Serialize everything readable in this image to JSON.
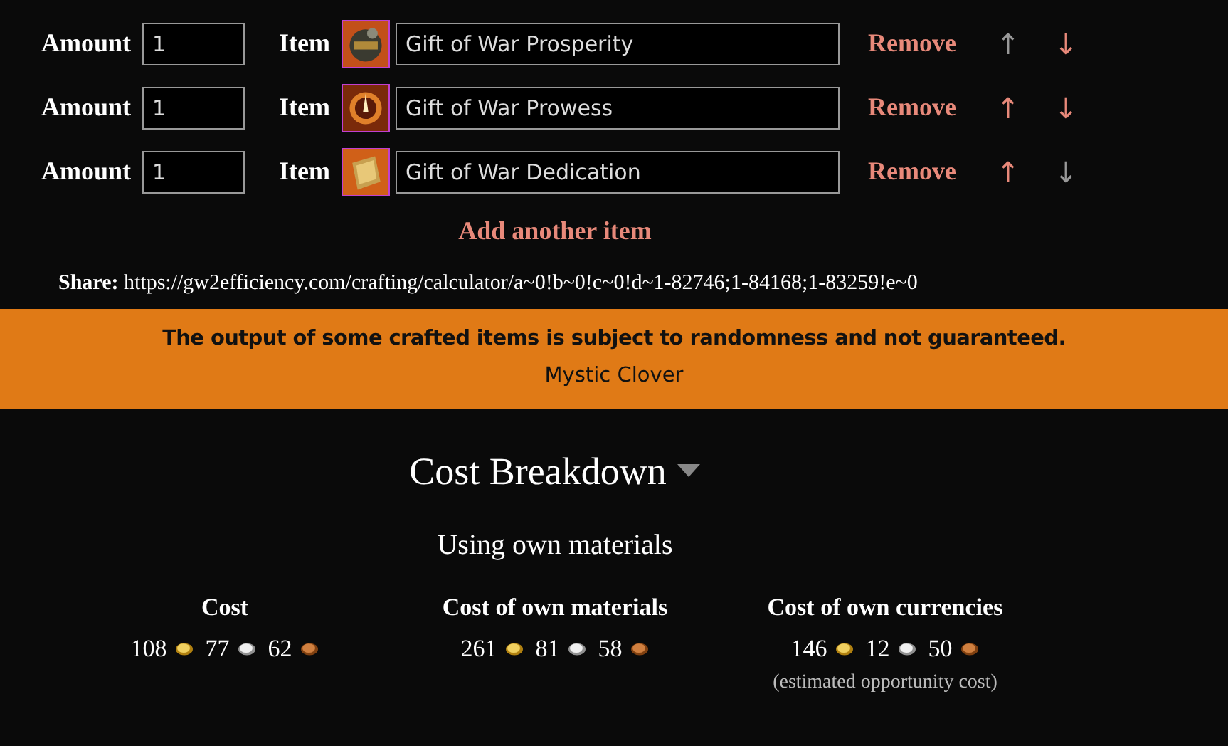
{
  "items": [
    {
      "amount_label": "Amount",
      "amount": "1",
      "item_label": "Item",
      "name": "Gift of War Prosperity",
      "remove": "Remove",
      "up": {
        "glyph": "↑",
        "disabled": true
      },
      "down": {
        "glyph": "↓",
        "disabled": false
      }
    },
    {
      "amount_label": "Amount",
      "amount": "1",
      "item_label": "Item",
      "name": "Gift of War Prowess",
      "remove": "Remove",
      "up": {
        "glyph": "↑",
        "disabled": false
      },
      "down": {
        "glyph": "↓",
        "disabled": false
      }
    },
    {
      "amount_label": "Amount",
      "amount": "1",
      "item_label": "Item",
      "name": "Gift of War Dedication",
      "remove": "Remove",
      "up": {
        "glyph": "↑",
        "disabled": false
      },
      "down": {
        "glyph": "↓",
        "disabled": true
      }
    }
  ],
  "add_item": "Add another item",
  "share": {
    "label": "Share:",
    "url": "https://gw2efficiency.com/crafting/calculator/a~0!b~0!c~0!d~1-82746;1-84168;1-83259!e~0"
  },
  "warning": {
    "message": "The output of some crafted items is subject to randomness and not guaranteed.",
    "item": "Mystic Clover"
  },
  "breakdown": {
    "title": "Cost Breakdown",
    "subtitle": "Using own materials",
    "columns": [
      {
        "heading": "Cost",
        "amounts": [
          {
            "kind": "gold",
            "value": "108"
          },
          {
            "kind": "silver",
            "value": "77"
          },
          {
            "kind": "copper",
            "value": "62"
          }
        ]
      },
      {
        "heading": "Cost of own materials",
        "amounts": [
          {
            "kind": "gold",
            "value": "261"
          },
          {
            "kind": "silver",
            "value": "81"
          },
          {
            "kind": "copper",
            "value": "58"
          }
        ]
      },
      {
        "heading": "Cost of own currencies",
        "amounts": [
          {
            "kind": "gold",
            "value": "146"
          },
          {
            "kind": "silver",
            "value": "12"
          },
          {
            "kind": "copper",
            "value": "50"
          }
        ],
        "note": "(estimated opportunity cost)"
      }
    ]
  }
}
